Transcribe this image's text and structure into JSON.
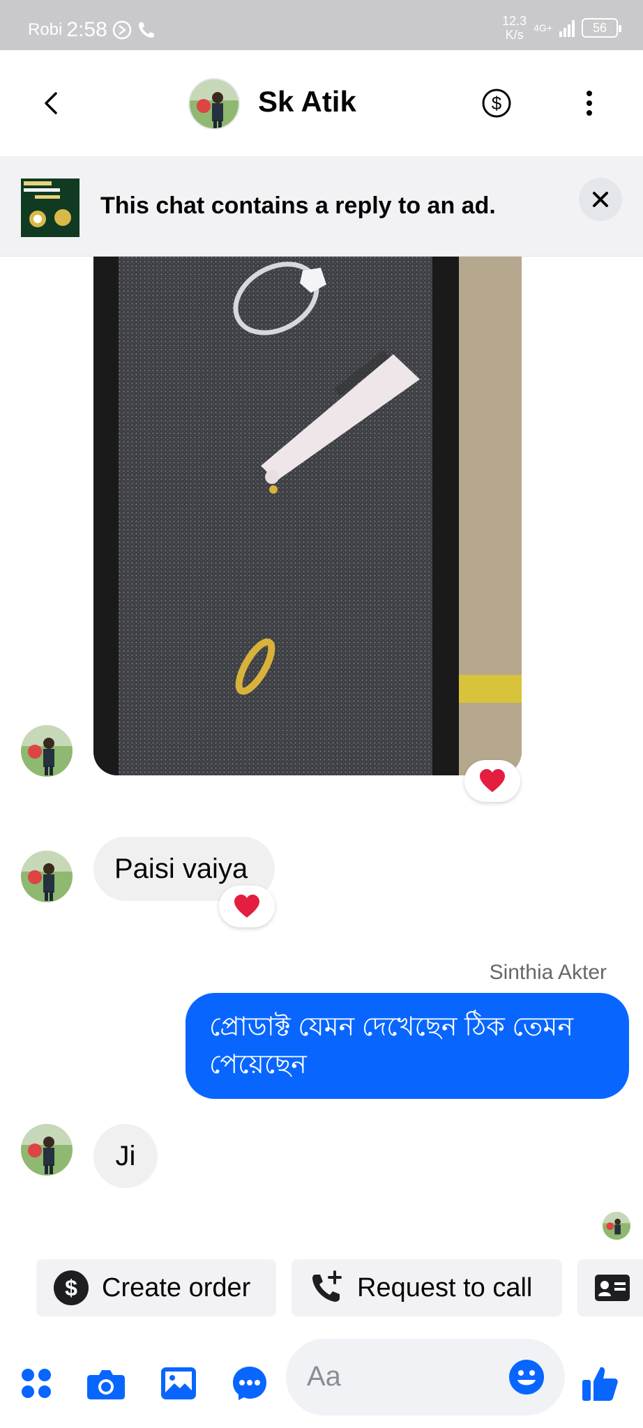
{
  "status_bar": {
    "carrier": "Robi",
    "time": "2:58",
    "speed_value": "12.3",
    "speed_unit": "K/s",
    "network": "4G+",
    "battery": "56"
  },
  "header": {
    "contact_name": "Sk Atik",
    "back_icon": "chevron-left-icon",
    "payment_icon": "dollar-circle-icon",
    "more_icon": "more-vertical-icon"
  },
  "ad_banner": {
    "text": "This chat contains a reply to an ad."
  },
  "messages": [
    {
      "type": "image",
      "sender": "contact",
      "reaction": "heart"
    },
    {
      "type": "text",
      "sender": "contact",
      "text": "Paisi vaiya",
      "reaction": "heart"
    },
    {
      "type": "text",
      "sender": "me",
      "sender_name": "Sinthia Akter",
      "text": "প্রোডাক্ট যেমন দেখেছেন ঠিক তেমন পেয়েছেন"
    },
    {
      "type": "text",
      "sender": "contact",
      "text": "Ji"
    }
  ],
  "quick_actions": {
    "create_order": "Create order",
    "request_call": "Request to call"
  },
  "composer": {
    "placeholder": "Aa"
  },
  "colors": {
    "accent": "#0866ff",
    "heart": "#e41e3f",
    "incoming_bubble": "#f0f0f0"
  }
}
